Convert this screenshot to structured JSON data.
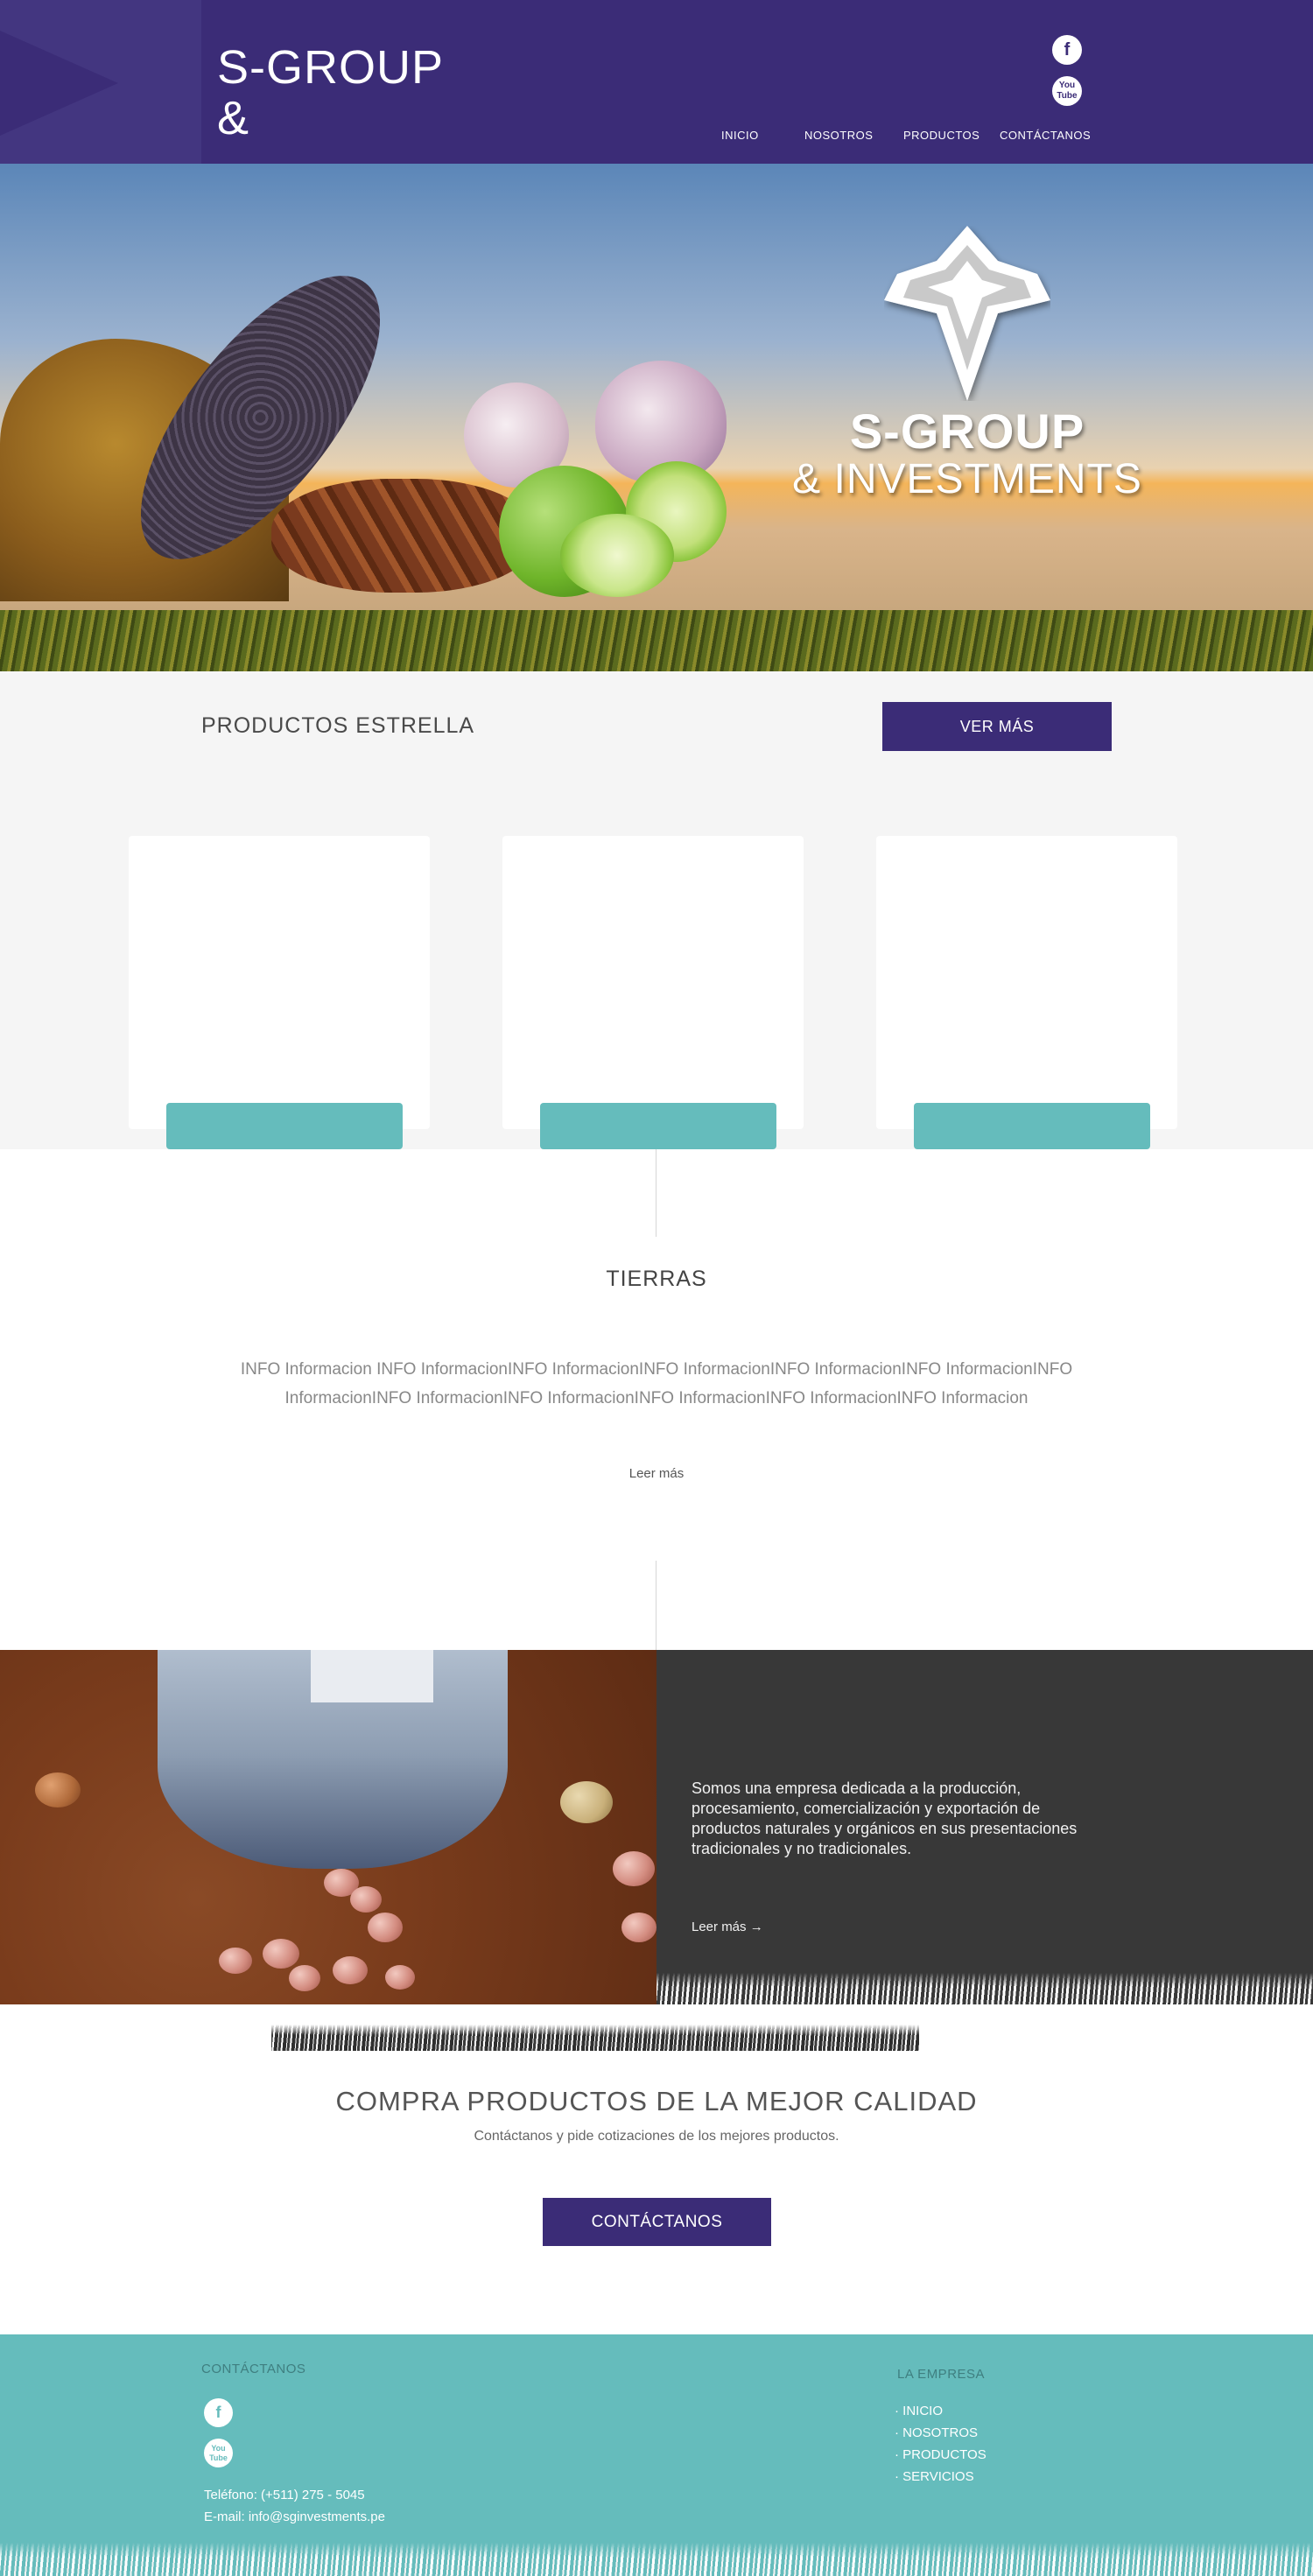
{
  "header": {
    "brand_line1": "S-GROUP",
    "brand_line2": "&",
    "social": {
      "facebook_glyph": "f",
      "youtube_glyph": "You Tube"
    },
    "nav": [
      "INICIO",
      "NOSOTROS",
      "PRODUCTOS",
      "CONTÁCTANOS"
    ]
  },
  "hero": {
    "brand_line1": "S-GROUP",
    "brand_line2": "& INVESTMENTS"
  },
  "productos": {
    "title": "PRODUCTOS ESTRELLA",
    "ver_mas": "VER MÁS"
  },
  "tierras": {
    "title": "TIERRAS",
    "body": "INFO Informacion INFO InformacionINFO InformacionINFO InformacionINFO InformacionINFO InformacionINFO InformacionINFO InformacionINFO InformacionINFO InformacionINFO InformacionINFO Informacion",
    "read_more": "Leer más"
  },
  "empresa": {
    "text": "Somos una empresa dedicada a la producción, procesamiento, comercialización y exportación de productos naturales y orgánicos en sus presentaciones tradicionales y no tradicionales.",
    "read_more": "Leer más →"
  },
  "cta": {
    "title": "COMPRA PRODUCTOS DE LA MEJOR CALIDAD",
    "subtitle": "Contáctanos y pide cotizaciones de los mejores productos.",
    "button": "CONTÁCTANOS"
  },
  "footer": {
    "contact_title": "CONTÁCTANOS",
    "phone": "Teléfono: (+511) 275 - 5045",
    "email": "E-mail: info@sginvestments.pe",
    "empresa_title": "LA EMPRESA",
    "links": [
      "· INICIO",
      "· NOSOTROS",
      "· PRODUCTOS",
      "· SERVICIOS"
    ]
  },
  "colors": {
    "brand_purple": "#3b2c77",
    "teal": "#65bcbc",
    "dark_panel": "#383838",
    "light_gray": "#f5f5f5"
  },
  "icons": [
    "facebook-icon",
    "youtube-icon",
    "star-logo-icon",
    "arrow-right-icon"
  ]
}
